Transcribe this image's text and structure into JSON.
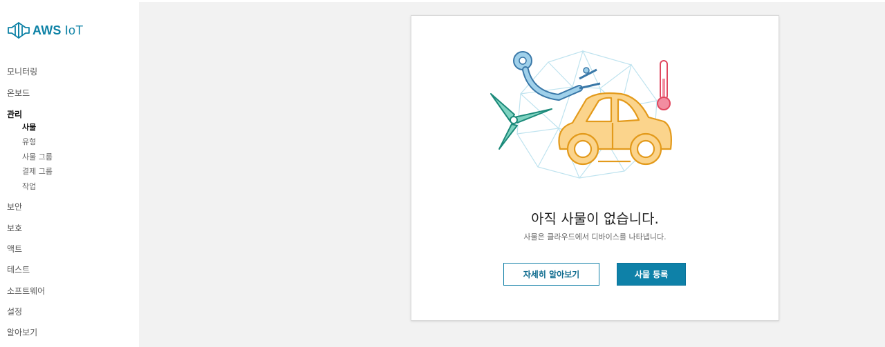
{
  "brand": {
    "logo_icon": "aws-iot-logo-icon",
    "name_bold": "AWS",
    "name_rest": " IoT",
    "color": "#0e82a6"
  },
  "sidebar": {
    "items": [
      {
        "label": "모니터링"
      },
      {
        "label": "온보드"
      },
      {
        "label": "관리",
        "active": true,
        "children": [
          {
            "label": "사물",
            "active": true
          },
          {
            "label": "유형"
          },
          {
            "label": "사물 그룹"
          },
          {
            "label": "결제 그룹"
          },
          {
            "label": "작업"
          }
        ]
      },
      {
        "label": "보안"
      },
      {
        "label": "보호"
      },
      {
        "label": "액트"
      },
      {
        "label": "테스트"
      },
      {
        "label": "소프트웨어"
      },
      {
        "label": "설정"
      },
      {
        "label": "알아보기"
      }
    ]
  },
  "main": {
    "illustration_icon": "iot-things-illustration-icon",
    "empty_title": "아직 사물이 없습니다.",
    "empty_description": "사물은 클라우드에서 디바이스를 나타냅니다.",
    "learn_more_label": "자세히 알아보기",
    "register_label": "사물 등록"
  },
  "colors": {
    "accent": "#0e81a8",
    "background": "#f2f2f2"
  }
}
